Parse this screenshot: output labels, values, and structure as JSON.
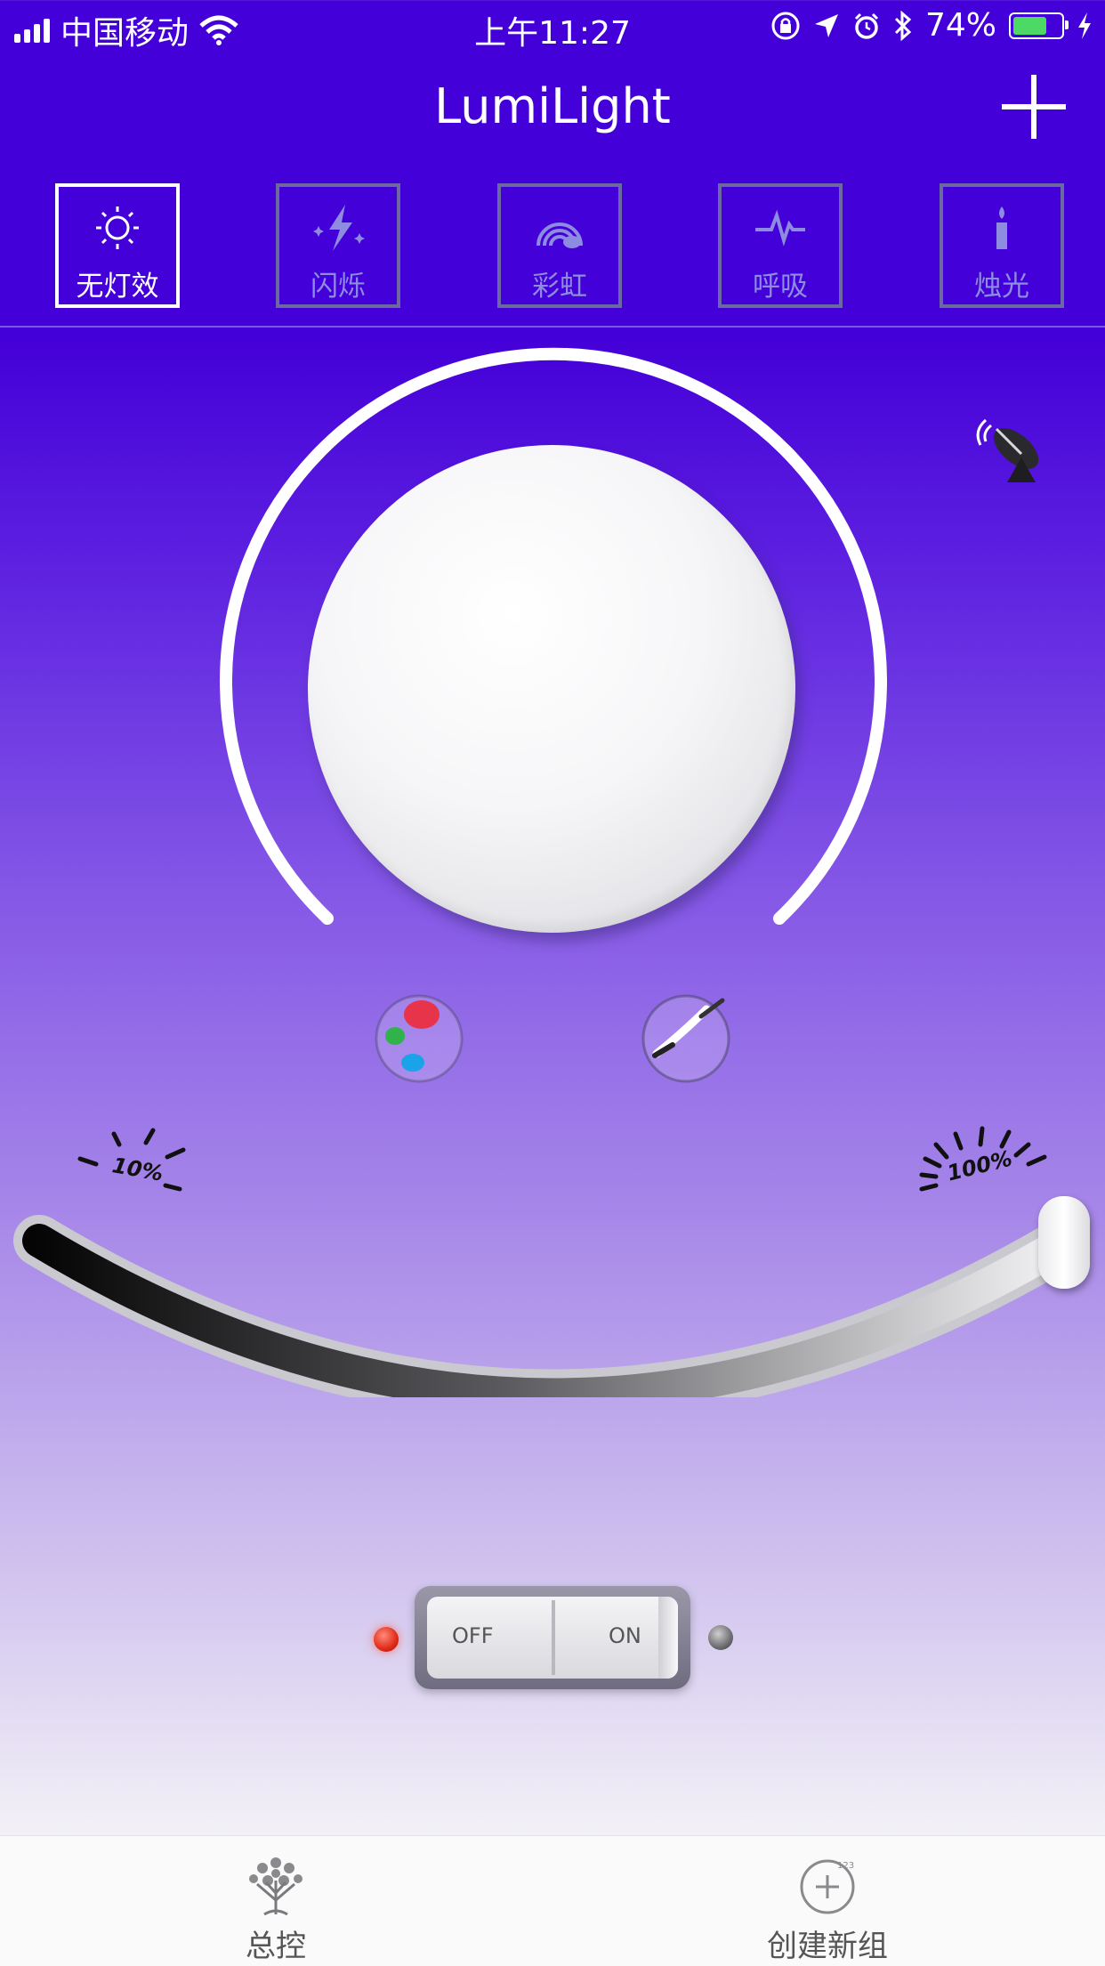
{
  "status_bar": {
    "carrier": "中国移动",
    "time": "上午11:27",
    "battery_percent": "74%",
    "battery_level": 0.74,
    "icons": [
      "signal-icon",
      "wifi-icon",
      "orientation-lock-icon",
      "location-icon",
      "alarm-icon",
      "bluetooth-icon",
      "battery-icon",
      "charging-icon"
    ]
  },
  "header": {
    "title": "LumiLight",
    "add_icon": "plus-icon"
  },
  "effects": [
    {
      "label": "无灯效",
      "icon": "sun-icon",
      "active": true
    },
    {
      "label": "闪烁",
      "icon": "lightning-sparkle-icon",
      "active": false
    },
    {
      "label": "彩虹",
      "icon": "rainbow-icon",
      "active": false
    },
    {
      "label": "呼吸",
      "icon": "pulse-icon",
      "active": false
    },
    {
      "label": "烛光",
      "icon": "candle-icon",
      "active": false
    }
  ],
  "dial": {
    "knob_color": "#ffffff"
  },
  "modes": {
    "color_icon": "color-palette-icon",
    "white_icon": "white-light-wand-icon"
  },
  "brightness": {
    "min_label": "10%",
    "max_label": "100%",
    "value": 1.0
  },
  "power": {
    "off_label": "OFF",
    "on_label": "ON",
    "state": "off"
  },
  "tabbar": [
    {
      "label": "总控",
      "icon": "tree-icon"
    },
    {
      "label": "创建新组",
      "icon": "add-group-icon",
      "badge": "123"
    }
  ],
  "colors": {
    "accent": "#4400d8",
    "active_tab": "#ffffff",
    "inactive_tab": "#8d8ce0"
  }
}
